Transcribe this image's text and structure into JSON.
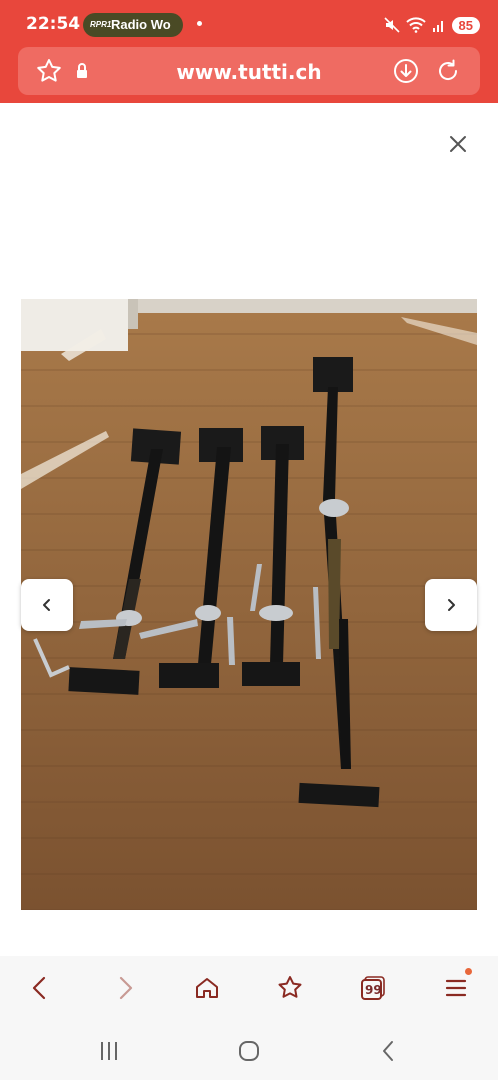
{
  "status_bar": {
    "time": "22:54",
    "radio_logo": "RPR1",
    "radio_name": "Radio Wo",
    "battery": "85"
  },
  "browser": {
    "url": "www.tutti.ch",
    "tab_count": "99"
  },
  "gallery": {
    "image_alt": "Four black steel adjustable construction props lying on a wooden floor"
  },
  "colors": {
    "brand": "#e8473c",
    "toolbar_icon": "#8a2a22"
  }
}
